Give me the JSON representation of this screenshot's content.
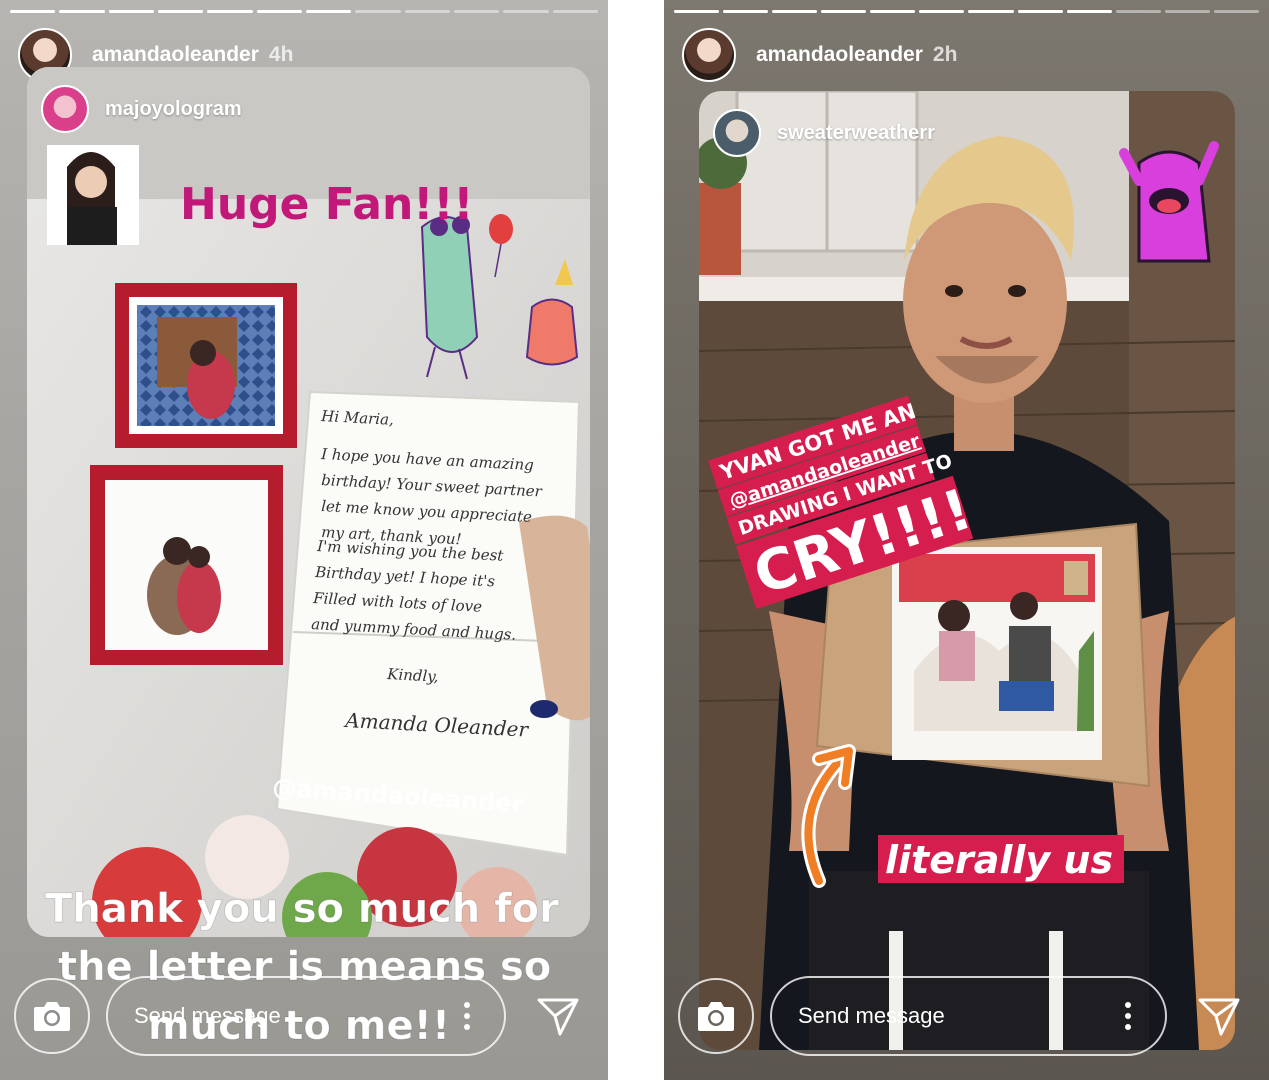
{
  "stories": [
    {
      "progress_total": 12,
      "progress_current": 7,
      "username": "amandaoleander",
      "time_ago": "4h",
      "reposted_from": "majoyologram",
      "sticker_headline": "Huge Fan!!!",
      "letter": {
        "greeting": "Hi Maria,",
        "para1": [
          "I hope you have an amazing",
          "birthday! Your sweet partner",
          "let me know you appreciate",
          "my art, thank you!"
        ],
        "para2": [
          "I'm wishing you the best",
          "Birthday yet! I hope it's",
          "Filled with lots of love",
          "and yummy food and hugs."
        ],
        "closing": "Kindly,",
        "signature": "Amanda Oleander"
      },
      "mention_tag": "@amandaoleander",
      "caption_lines": [
        "Thank you so much for",
        "the letter is means so",
        "much to me!!"
      ],
      "message_placeholder": "Send message"
    },
    {
      "progress_total": 12,
      "progress_current": 9,
      "username": "amandaoleander",
      "time_ago": "2h",
      "reposted_from": "sweaterweatherr",
      "caption_line1": "YVAN GOT ME AN",
      "caption_mention": "@amandaoleander",
      "caption_line3": "DRAWING I WANT TO",
      "caption_cry": "CRY!!!!",
      "caption_literally": "literally us",
      "message_placeholder": "Send message"
    }
  ]
}
